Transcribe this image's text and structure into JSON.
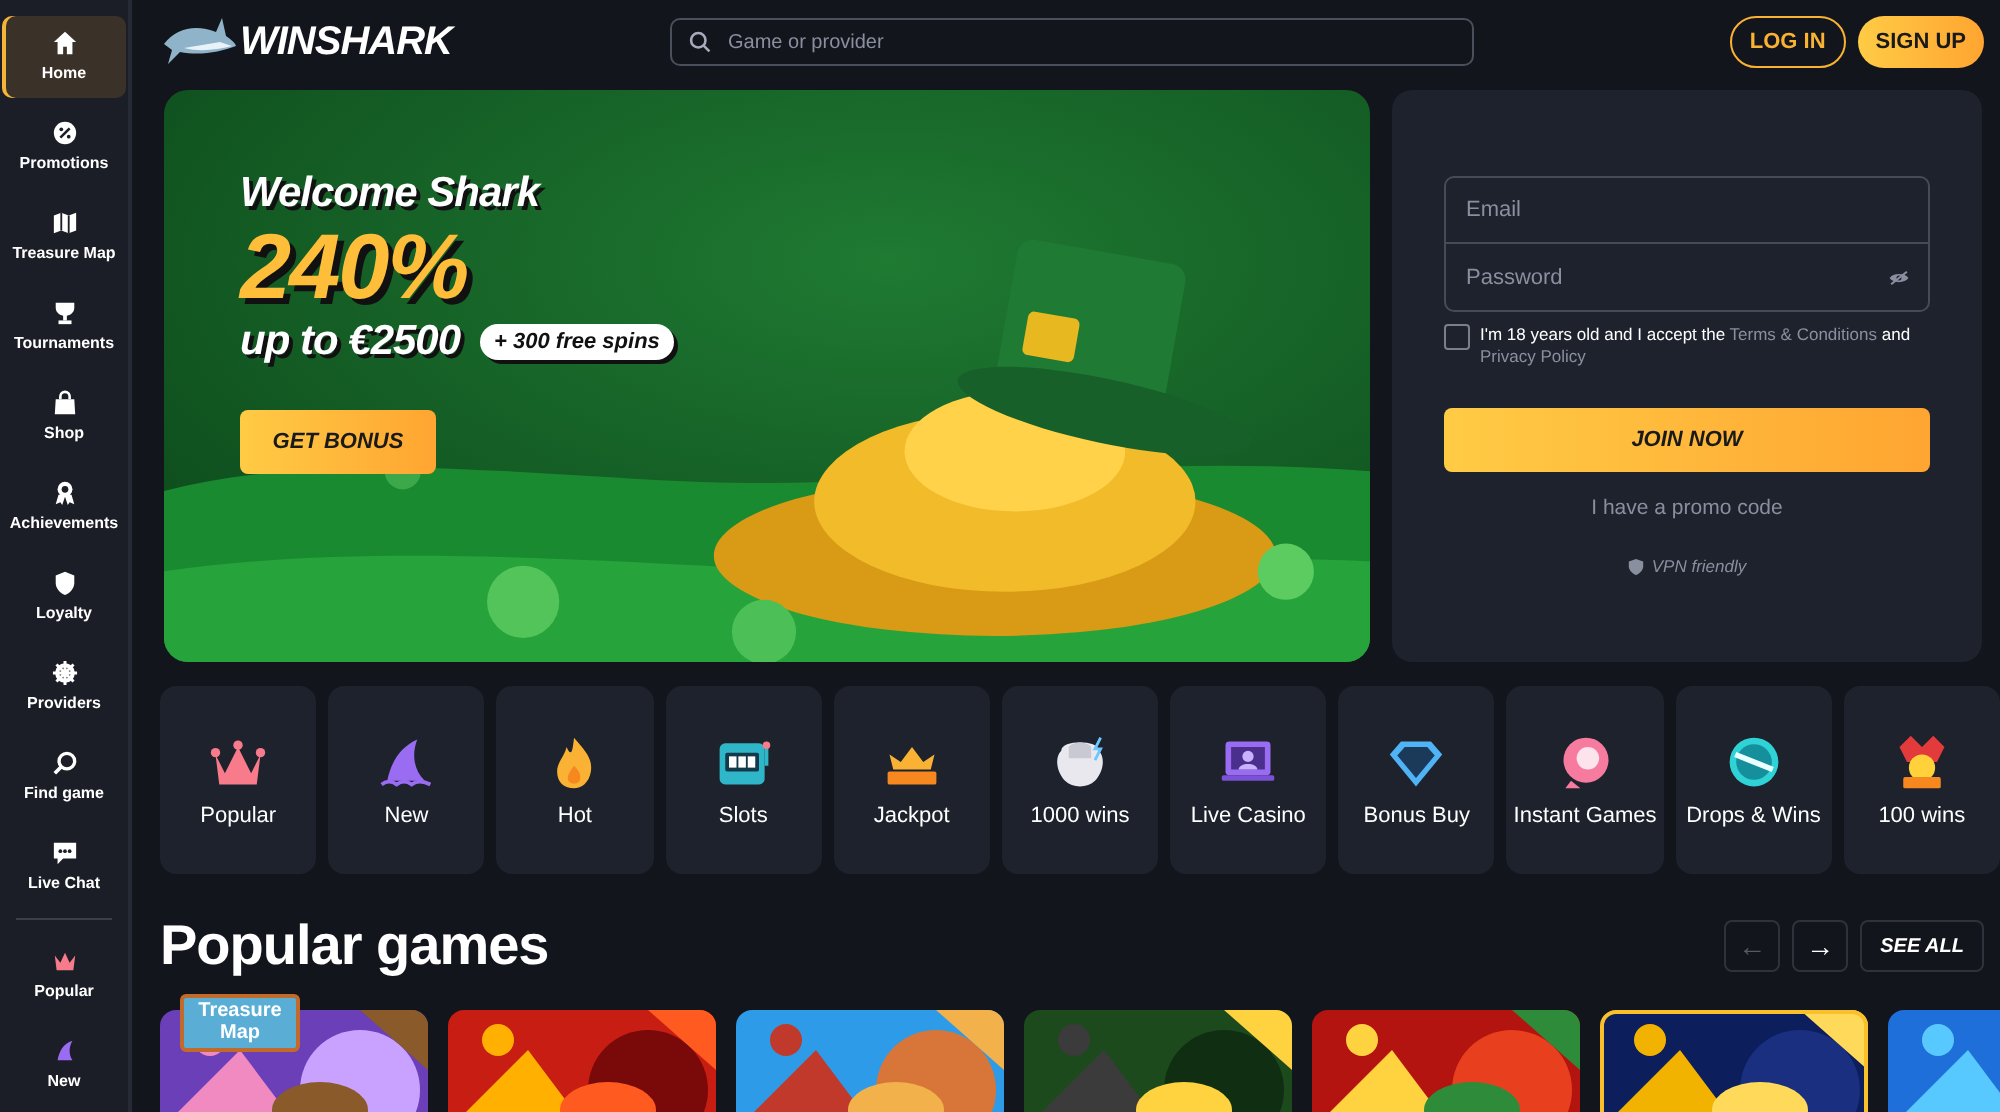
{
  "sidebar": {
    "items": [
      {
        "label": "Home",
        "selected": true
      },
      {
        "label": "Promotions",
        "selected": false
      },
      {
        "label": "Treasure Map",
        "selected": false
      },
      {
        "label": "Tournaments",
        "selected": false
      },
      {
        "label": "Shop",
        "selected": false
      },
      {
        "label": "Achievements",
        "selected": false
      },
      {
        "label": "Loyalty",
        "selected": false
      },
      {
        "label": "Providers",
        "selected": false
      },
      {
        "label": "Find game",
        "selected": false
      },
      {
        "label": "Live Chat",
        "selected": false
      }
    ],
    "featured": [
      {
        "label": "Popular",
        "selected": false
      },
      {
        "label": "New",
        "selected": false
      }
    ]
  },
  "header": {
    "logo": "WINSHARK",
    "search": {
      "placeholder": "Game or provider"
    },
    "buttons": [
      {
        "label": "LOG IN",
        "kind": "outline"
      },
      {
        "label": "SIGN UP",
        "kind": "filled"
      }
    ]
  },
  "hero": {
    "title": "Welcome Shark",
    "percent": "240%",
    "amount": "up to €2500",
    "badge": "+ 300 free spins",
    "button": "GET BONUS"
  },
  "register": {
    "email": {
      "placeholder": "Email"
    },
    "password": {
      "placeholder": "Password"
    },
    "consent": {
      "checked": false,
      "text": "I'm 18 years old and I accept the",
      "terms_link": "Terms & Conditions",
      "joiner": "and",
      "privacy_link": "Privacy Policy"
    },
    "join_button": "JOIN NOW",
    "promo_link": "I have a promo code",
    "vpn_note": "VPN friendly"
  },
  "categories": [
    {
      "label": "Popular"
    },
    {
      "label": "New"
    },
    {
      "label": "Hot"
    },
    {
      "label": "Slots"
    },
    {
      "label": "Jackpot"
    },
    {
      "label": "1000 wins"
    },
    {
      "label": "Live Casino"
    },
    {
      "label": "Bonus Buy"
    },
    {
      "label": "Instant Games"
    },
    {
      "label": "Drops & Wins"
    },
    {
      "label": "100 wins"
    }
  ],
  "popular_games": {
    "title": "Popular games",
    "prev": {
      "label": "←",
      "disabled": true
    },
    "next": {
      "label": "→",
      "disabled": false
    },
    "see_all": "SEE ALL",
    "games": [
      {
        "kind": "picture",
        "badge": "Treasure Map"
      },
      {
        "kind": "picture"
      },
      {
        "kind": "picture"
      },
      {
        "kind": "picture"
      },
      {
        "kind": "picture"
      },
      {
        "kind": "picture"
      },
      {
        "kind": "picture"
      }
    ]
  }
}
